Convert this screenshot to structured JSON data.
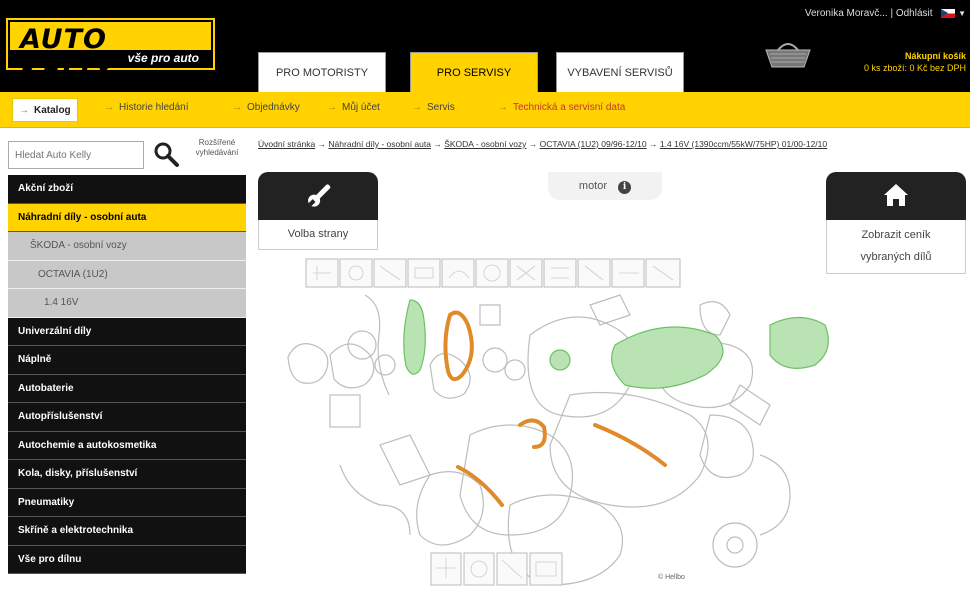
{
  "header": {
    "logo_main": "AUTO KELLY",
    "logo_sub": "vše pro auto",
    "tabs": [
      {
        "label": "PRO MOTORISTY"
      },
      {
        "label": "PRO SERVISY"
      },
      {
        "label": "VYBAVENÍ SERVISŮ"
      }
    ],
    "user_name": "Veronika Moravč...",
    "logout": "Odhlásit",
    "language_icon": "czech-flag-icon",
    "cart_label": "Nákupní košík",
    "cart_value": "0 ks zboží: 0 Kč bez DPH"
  },
  "subnav": {
    "items": [
      {
        "label": "Katalog"
      },
      {
        "label": "Historie hledání"
      },
      {
        "label": "Objednávky"
      },
      {
        "label": "Můj účet"
      },
      {
        "label": "Servis"
      },
      {
        "label": "Technická a servisní data"
      }
    ]
  },
  "search": {
    "placeholder": "Hledat Auto Kelly",
    "advanced": "Rozšířené vyhledávání"
  },
  "breadcrumb": {
    "items": [
      "Úvodní stránka",
      "Náhradní díly - osobní auta",
      "ŠKODA - osobní vozy",
      "OCTAVIA (1U2) 09/96-12/10",
      "1.4 16V (1390ccm/55kW/75HP) 01/00-12/10"
    ],
    "sep": "→"
  },
  "sidebar": {
    "items": [
      {
        "label": "Akční zboží"
      },
      {
        "label": "Náhradní díly - osobní auta"
      },
      {
        "label": "ŠKODA - osobní vozy"
      },
      {
        "label": "OCTAVIA (1U2)"
      },
      {
        "label": "1.4 16V"
      },
      {
        "label": "Univerzální díly"
      },
      {
        "label": "Nápl­ně"
      },
      {
        "label": "Autobaterie"
      },
      {
        "label": "Autopříslušenství"
      },
      {
        "label": "Autochemie a autokosmetika"
      },
      {
        "label": "Kola, disky, příslušenství"
      },
      {
        "label": "Pneumatiky"
      },
      {
        "label": "Skříně a elektrotechnika"
      },
      {
        "label": "Vše pro dílnu"
      }
    ]
  },
  "main": {
    "page_select": "Volba strany",
    "motor_tab": "motor",
    "pricelist_line1": "Zobrazit ceník",
    "pricelist_line2": "vybraných dílů",
    "copyright": "© Hellbo"
  },
  "colors": {
    "brand_yellow": "#ffd200",
    "part_green": "#8fd18a",
    "part_orange": "#e08a2a"
  }
}
